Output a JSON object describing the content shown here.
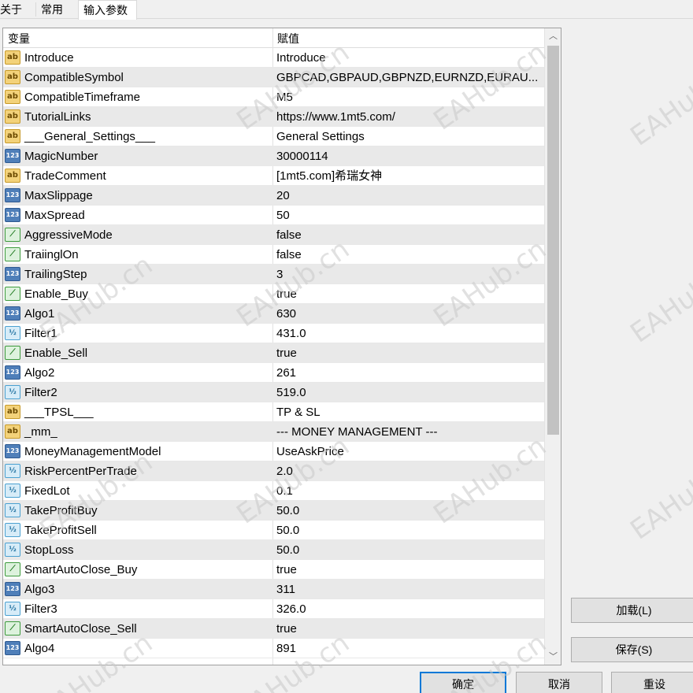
{
  "tabs": [
    {
      "label": "关于"
    },
    {
      "label": "常用"
    },
    {
      "label": "输入参数"
    }
  ],
  "grid": {
    "header": {
      "name": "变量",
      "value": "赋值"
    },
    "rows": [
      {
        "type": "ab",
        "name": "Introduce",
        "value": "Introduce"
      },
      {
        "type": "ab",
        "name": "CompatibleSymbol",
        "value": "GBPCAD,GBPAUD,GBPNZD,EURNZD,EURAU..."
      },
      {
        "type": "ab",
        "name": "CompatibleTimeframe",
        "value": "M5"
      },
      {
        "type": "ab",
        "name": "TutorialLinks",
        "value": "https://www.1mt5.com/"
      },
      {
        "type": "ab",
        "name": "___General_Settings___",
        "value": "General Settings"
      },
      {
        "type": "num",
        "name": "MagicNumber",
        "value": "30000114"
      },
      {
        "type": "ab",
        "name": "TradeComment",
        "value": "[1mt5.com]希瑞女神"
      },
      {
        "type": "num",
        "name": "MaxSlippage",
        "value": "20"
      },
      {
        "type": "num",
        "name": "MaxSpread",
        "value": "50"
      },
      {
        "type": "bool",
        "name": "AggressiveMode",
        "value": "false"
      },
      {
        "type": "bool",
        "name": "TraiinglOn",
        "value": "false"
      },
      {
        "type": "num",
        "name": "TrailingStep",
        "value": "3"
      },
      {
        "type": "bool",
        "name": "Enable_Buy",
        "value": "true"
      },
      {
        "type": "num",
        "name": "Algo1",
        "value": "630"
      },
      {
        "type": "dbl",
        "name": "Filter1",
        "value": "431.0"
      },
      {
        "type": "bool",
        "name": "Enable_Sell",
        "value": "true"
      },
      {
        "type": "num",
        "name": "Algo2",
        "value": "261"
      },
      {
        "type": "dbl",
        "name": "Filter2",
        "value": "519.0"
      },
      {
        "type": "ab",
        "name": "___TPSL___",
        "value": "TP & SL"
      },
      {
        "type": "ab",
        "name": "_mm_",
        "value": "--- MONEY MANAGEMENT ---"
      },
      {
        "type": "num",
        "name": "MoneyManagementModel",
        "value": "UseAskPrice"
      },
      {
        "type": "dbl",
        "name": "RiskPercentPerTrade",
        "value": "2.0"
      },
      {
        "type": "dbl",
        "name": "FixedLot",
        "value": "0.1"
      },
      {
        "type": "dbl",
        "name": "TakeProfitBuy",
        "value": "50.0"
      },
      {
        "type": "dbl",
        "name": "TakeProfitSell",
        "value": "50.0"
      },
      {
        "type": "dbl",
        "name": "StopLoss",
        "value": "50.0"
      },
      {
        "type": "bool",
        "name": "SmartAutoClose_Buy",
        "value": "true"
      },
      {
        "type": "num",
        "name": "Algo3",
        "value": "311"
      },
      {
        "type": "dbl",
        "name": "Filter3",
        "value": "326.0"
      },
      {
        "type": "bool",
        "name": "SmartAutoClose_Sell",
        "value": "true"
      },
      {
        "type": "num",
        "name": "Algo4",
        "value": "891"
      }
    ]
  },
  "icons": {
    "ab": {
      "glyph": "ab",
      "name": "string-type-icon"
    },
    "num": {
      "glyph": "123",
      "name": "integer-type-icon"
    },
    "bool": {
      "glyph": "⟋",
      "name": "boolean-type-icon"
    },
    "dbl": {
      "glyph": "½",
      "name": "double-type-icon"
    }
  },
  "buttons": {
    "load": "加载(L)",
    "save": "保存(S)",
    "ok": "确定",
    "cancel": "取消",
    "reset": "重设"
  },
  "watermark": "EAHub.cn",
  "colors": {
    "accent": "#0078d7",
    "alt_row": "#e9e9e9",
    "button_bg": "#e1e1e1"
  }
}
